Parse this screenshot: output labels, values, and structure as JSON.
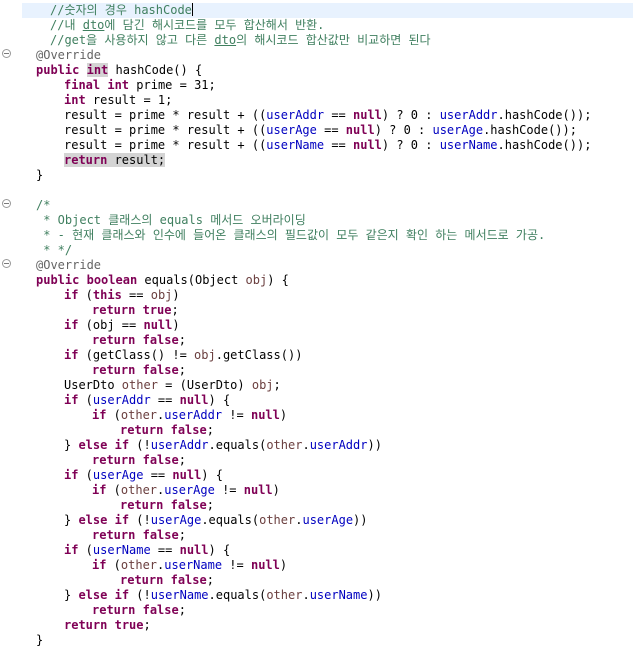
{
  "editor": {
    "comments": {
      "c1": "//숫자의 경우 hashCode",
      "c2_pre": "//내 ",
      "c2_dto": "dto",
      "c2_post": "에 담긴 해시코드를 모두 합산해서 반환.",
      "c3_pre": "//get을 사용하지 않고 다른 ",
      "c3_dto": "dto",
      "c3_post": "의 해시코드 합산값만 비교하면 된다",
      "javadoc_open": "/*",
      "javadoc_1": " * Object 클래스의 equals 메서드 오버라이딩",
      "javadoc_2": " * - 현재 클래스와 인수에 들어온 클래스의 필드값이 모두 같은지 확인 하는 메서드로 가공.",
      "javadoc_close": " * */"
    },
    "keywords": {
      "public": "public",
      "int": "int",
      "final": "final",
      "null": "null",
      "return": "return",
      "boolean": "boolean",
      "if": "if",
      "this": "this",
      "true": "true",
      "false": "false",
      "else": "else"
    },
    "annotation": "@Override",
    "idents": {
      "hashCode_sig": " hashCode() {",
      "prime": " prime = 31;",
      "result_init": " result = 1;",
      "result_eq": "result = prime * result + ((",
      "addr_field": "userAddr",
      "age_field": "userAge",
      "name_field": "userName",
      "eq_null": " == ",
      "tern_mid": ") ? 0 : ",
      "hash_call": ".hashCode());",
      "result_return": " result;",
      "close_brace": "}",
      "equals_sig": " equals(Object ",
      "obj": "obj",
      "sig_end": ") {",
      "if_open": " (",
      "if_this_end": ")",
      "semi": ";",
      "neq": " != ",
      "getclass_1": " (getClass() != ",
      "getclass_2": ".getClass())",
      "other_decl_1": "UserDto ",
      "other": "other",
      "other_decl_2": " = (UserDto) ",
      "obj_semi": ";",
      "brace_open": ") {",
      "close_if_else": "} ",
      "not_open": " (!",
      "equals_call": ".equals(",
      "dot": ".",
      "dbl_close": "))",
      "obj_paren": " (obj",
      "paren_close": ")"
    }
  }
}
